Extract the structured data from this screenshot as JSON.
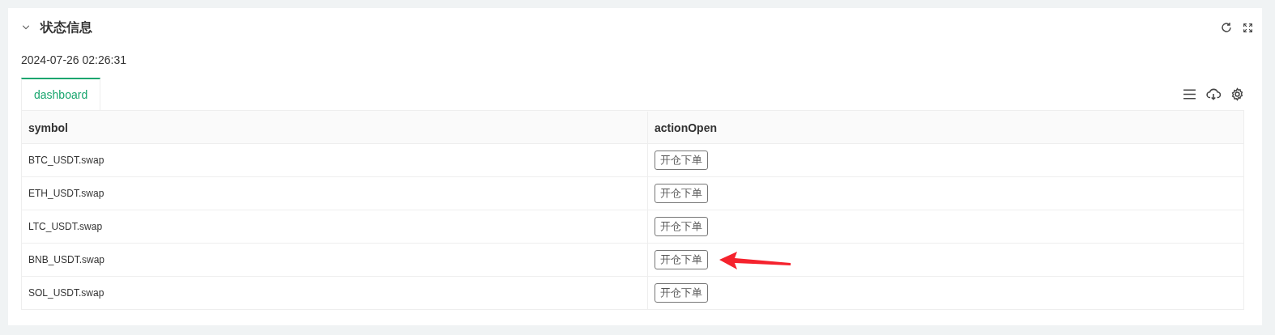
{
  "panel": {
    "title": "状态信息",
    "expanded": true,
    "timestamp": "2024-07-26 02:26:31"
  },
  "tabs": [
    {
      "label": "dashboard",
      "selected": true
    }
  ],
  "table": {
    "columns": [
      "symbol",
      "actionOpen"
    ],
    "rows": [
      {
        "symbol": "BTC_USDT.swap",
        "action": "开仓下单",
        "annotated": false
      },
      {
        "symbol": "ETH_USDT.swap",
        "action": "开仓下单",
        "annotated": false
      },
      {
        "symbol": "LTC_USDT.swap",
        "action": "开仓下单",
        "annotated": false
      },
      {
        "symbol": "BNB_USDT.swap",
        "action": "开仓下单",
        "annotated": true
      },
      {
        "symbol": "SOL_USDT.swap",
        "action": "开仓下单",
        "annotated": false
      }
    ]
  }
}
